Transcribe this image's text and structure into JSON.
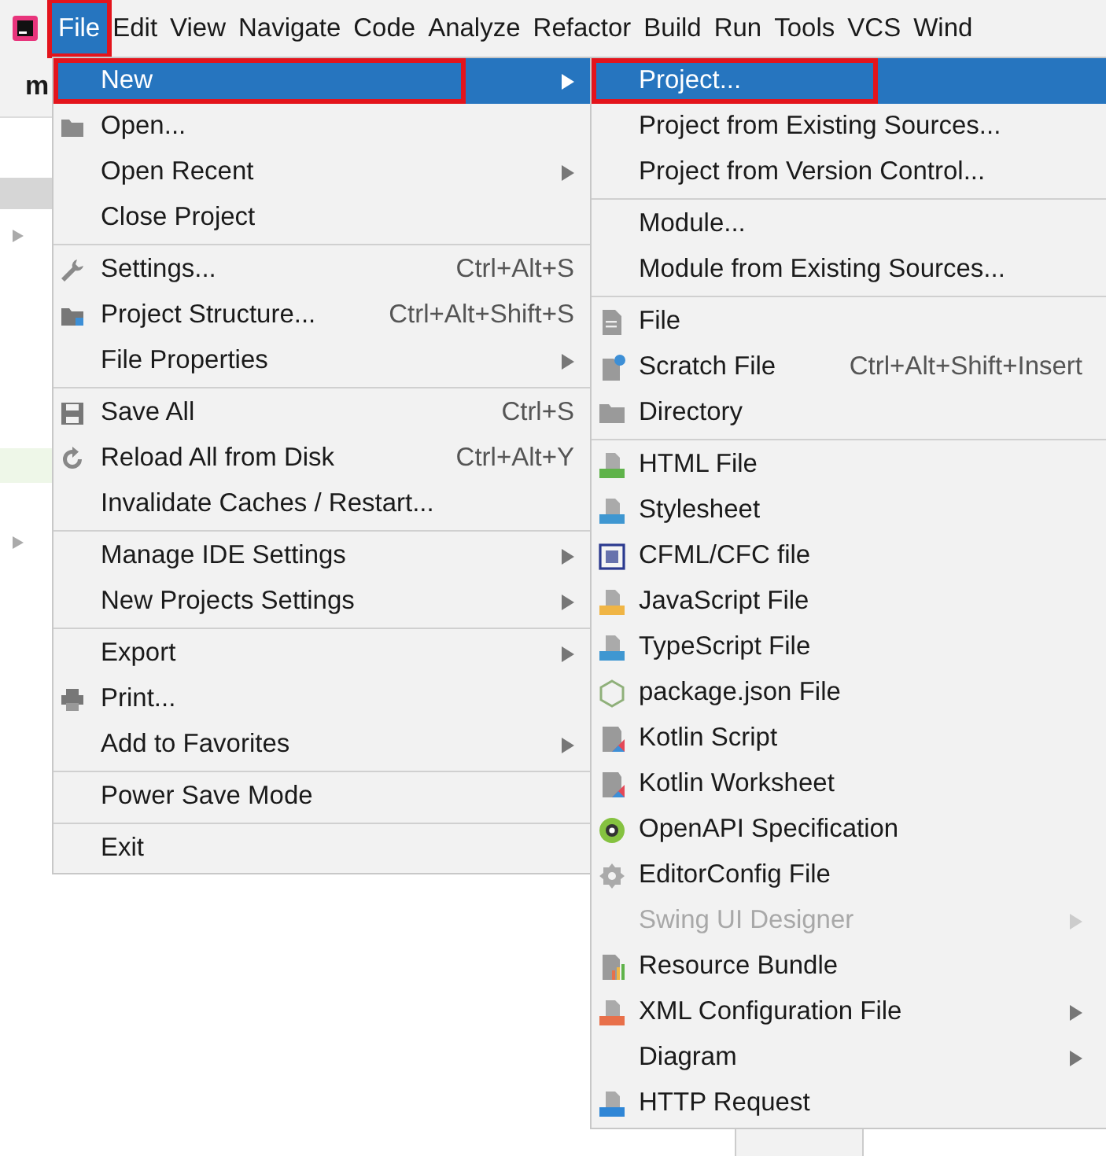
{
  "menu_bar": [
    {
      "label": "File",
      "selected": true,
      "highlighted": true
    },
    {
      "label": "Edit",
      "selected": false,
      "highlighted": false
    },
    {
      "label": "View",
      "selected": false,
      "highlighted": false
    },
    {
      "label": "Navigate",
      "selected": false,
      "highlighted": false
    },
    {
      "label": "Code",
      "selected": false,
      "highlighted": false
    },
    {
      "label": "Analyze",
      "selected": false,
      "highlighted": false
    },
    {
      "label": "Refactor",
      "selected": false,
      "highlighted": false
    },
    {
      "label": "Build",
      "selected": false,
      "highlighted": false
    },
    {
      "label": "Run",
      "selected": false,
      "highlighted": false
    },
    {
      "label": "Tools",
      "selected": false,
      "highlighted": false
    },
    {
      "label": "VCS",
      "selected": false,
      "highlighted": false
    },
    {
      "label": "Wind",
      "selected": false,
      "highlighted": false
    }
  ],
  "project_label": "m",
  "file_menu": {
    "items": [
      {
        "kind": "item",
        "label": "New",
        "submenu": true,
        "selected": true,
        "highlighted": true
      },
      {
        "kind": "item",
        "label": "Open...",
        "selected": false
      },
      {
        "kind": "item",
        "label": "Open Recent",
        "submenu": true,
        "selected": false
      },
      {
        "kind": "item",
        "label": "Close Project",
        "selected": false
      },
      {
        "kind": "separator"
      },
      {
        "kind": "item",
        "label": "Settings...",
        "shortcut": "Ctrl+Alt+S",
        "selected": false
      },
      {
        "kind": "item",
        "label": "Project Structure...",
        "shortcut": "Ctrl+Alt+Shift+S",
        "selected": false
      },
      {
        "kind": "item",
        "label": "File Properties",
        "submenu": true,
        "selected": false
      },
      {
        "kind": "separator"
      },
      {
        "kind": "item",
        "label": "Save All",
        "shortcut": "Ctrl+S",
        "selected": false
      },
      {
        "kind": "item",
        "label": "Reload All from Disk",
        "shortcut": "Ctrl+Alt+Y",
        "selected": false
      },
      {
        "kind": "item",
        "label": "Invalidate Caches / Restart...",
        "selected": false
      },
      {
        "kind": "separator"
      },
      {
        "kind": "item",
        "label": "Manage IDE Settings",
        "submenu": true,
        "selected": false
      },
      {
        "kind": "item",
        "label": "New Projects Settings",
        "submenu": true,
        "selected": false
      },
      {
        "kind": "separator"
      },
      {
        "kind": "item",
        "label": "Export",
        "submenu": true,
        "selected": false
      },
      {
        "kind": "item",
        "label": "Print...",
        "selected": false
      },
      {
        "kind": "item",
        "label": "Add to Favorites",
        "submenu": true,
        "selected": false
      },
      {
        "kind": "separator"
      },
      {
        "kind": "item",
        "label": "Power Save Mode",
        "selected": false
      },
      {
        "kind": "separator"
      },
      {
        "kind": "item",
        "label": "Exit",
        "selected": false
      }
    ]
  },
  "new_submenu": {
    "items": [
      {
        "kind": "item",
        "label": "Project...",
        "selected": true,
        "highlighted": true
      },
      {
        "kind": "item",
        "label": "Project from Existing Sources...",
        "selected": false
      },
      {
        "kind": "item",
        "label": "Project from Version Control...",
        "selected": false
      },
      {
        "kind": "separator"
      },
      {
        "kind": "item",
        "label": "Module...",
        "selected": false
      },
      {
        "kind": "item",
        "label": "Module from Existing Sources...",
        "selected": false
      },
      {
        "kind": "separator"
      },
      {
        "kind": "item",
        "label": "File",
        "selected": false
      },
      {
        "kind": "item",
        "label": "Scratch File",
        "shortcut": "Ctrl+Alt+Shift+Insert",
        "selected": false
      },
      {
        "kind": "item",
        "label": "Directory",
        "selected": false
      },
      {
        "kind": "separator"
      },
      {
        "kind": "item",
        "label": "HTML File",
        "selected": false
      },
      {
        "kind": "item",
        "label": "Stylesheet",
        "selected": false
      },
      {
        "kind": "item",
        "label": "CFML/CFC file",
        "selected": false
      },
      {
        "kind": "item",
        "label": "JavaScript File",
        "selected": false
      },
      {
        "kind": "item",
        "label": "TypeScript File",
        "selected": false
      },
      {
        "kind": "item",
        "label": "package.json File",
        "selected": false
      },
      {
        "kind": "item",
        "label": "Kotlin Script",
        "selected": false
      },
      {
        "kind": "item",
        "label": "Kotlin Worksheet",
        "selected": false
      },
      {
        "kind": "item",
        "label": "OpenAPI Specification",
        "selected": false
      },
      {
        "kind": "item",
        "label": "EditorConfig File",
        "selected": false
      },
      {
        "kind": "item",
        "label": "Swing UI Designer",
        "submenu": true,
        "disabled": true,
        "selected": false
      },
      {
        "kind": "item",
        "label": "Resource Bundle",
        "selected": false
      },
      {
        "kind": "item",
        "label": "XML Configuration File",
        "submenu": true,
        "selected": false
      },
      {
        "kind": "item",
        "label": "Diagram",
        "submenu": true,
        "selected": false
      },
      {
        "kind": "item",
        "label": "HTTP Request",
        "selected": false
      }
    ]
  }
}
